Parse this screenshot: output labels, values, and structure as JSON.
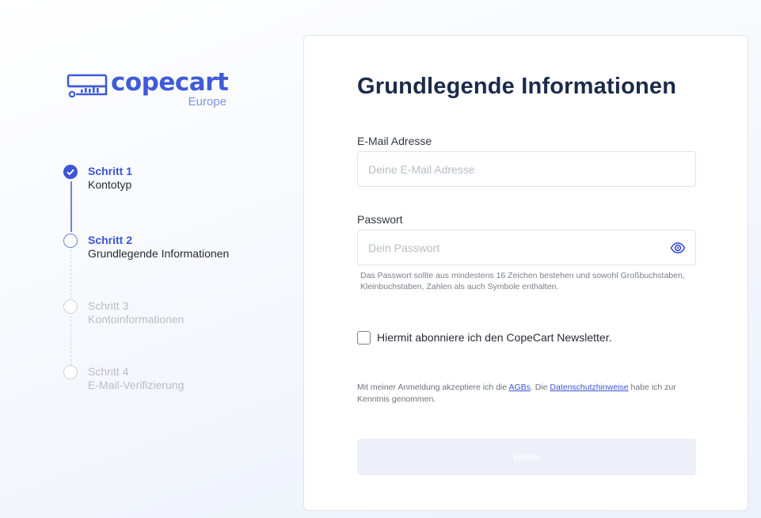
{
  "brand": {
    "name": "copecart",
    "region": "Europe",
    "color": "#3f5bd8"
  },
  "steps": [
    {
      "title": "Schritt 1",
      "subtitle": "Kontotyp",
      "state": "done",
      "icon": "check-circle-icon"
    },
    {
      "title": "Schritt 2",
      "subtitle": "Grundlegende Informationen",
      "state": "current",
      "icon": "ring-circle-icon"
    },
    {
      "title": "Schritt 3",
      "subtitle": "Kontoinformationen",
      "state": "pending",
      "icon": "empty-circle-icon"
    },
    {
      "title": "Schritt 4",
      "subtitle": "E-Mail-Verifizierung",
      "state": "pending",
      "icon": "empty-circle-icon"
    }
  ],
  "form": {
    "title": "Grundlegende Informationen",
    "email": {
      "label": "E-Mail Adresse",
      "placeholder": "Deine E-Mail Adresse",
      "value": ""
    },
    "password": {
      "label": "Passwort",
      "placeholder": "Dein Passwort",
      "value": "",
      "hint": "Das Passwort sollte aus mindestens 16 Zeichen bestehen und sowohl Großbuchstaben, Kleinbuchstaben, Zahlen als auch Symbole enthalten.",
      "toggle_icon": "eye-icon"
    },
    "newsletter": {
      "label": "Hiermit abonniere ich den CopeCart Newsletter.",
      "checked": false
    },
    "legal": {
      "prefix": "Mit meiner Anmeldung akzeptiere ich die ",
      "agb_link": "AGBs",
      "middle": ". Die ",
      "privacy_link": "Datenschutzhinweise",
      "suffix": " habe ich zur Kenntnis genommen."
    },
    "submit_label": "Weiter",
    "submit_enabled": false
  },
  "colors": {
    "accent": "#3b55d6",
    "accent_light": "#6c84e6",
    "pending": "#cfd3da",
    "button_disabled_bg": "#edf0f9"
  }
}
